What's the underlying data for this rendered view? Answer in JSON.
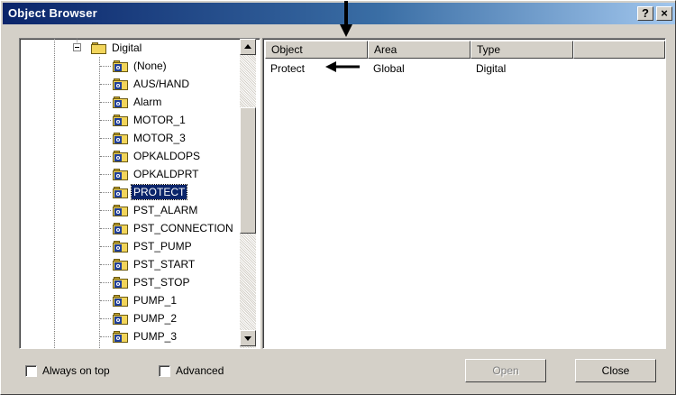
{
  "window": {
    "title": "Object Browser",
    "help_glyph": "?",
    "close_glyph": "×"
  },
  "tree": {
    "parent": {
      "label": "Digital",
      "icon": "folder-icon",
      "expanded": true
    },
    "badge": "o",
    "items": [
      {
        "label": "(None)"
      },
      {
        "label": "AUS/HAND"
      },
      {
        "label": "Alarm"
      },
      {
        "label": "MOTOR_1"
      },
      {
        "label": "MOTOR_3"
      },
      {
        "label": "OPKALDOPS"
      },
      {
        "label": "OPKALDPRT"
      },
      {
        "label": "PROTECT",
        "selected": true
      },
      {
        "label": "PST_ALARM"
      },
      {
        "label": "PST_CONNECTION"
      },
      {
        "label": "PST_PUMP"
      },
      {
        "label": "PST_START"
      },
      {
        "label": "PST_STOP"
      },
      {
        "label": "PUMP_1"
      },
      {
        "label": "PUMP_2"
      },
      {
        "label": "PUMP_3"
      }
    ]
  },
  "list": {
    "columns": [
      "Object",
      "Area",
      "Type"
    ],
    "rows": [
      [
        "Protect",
        "Global",
        "Digital"
      ]
    ]
  },
  "options": {
    "always_on_top": {
      "label": "Always on top",
      "checked": false
    },
    "advanced": {
      "label": "Advanced",
      "checked": false
    }
  },
  "buttons": {
    "open": {
      "label": "Open",
      "enabled": false
    },
    "close": {
      "label": "Close",
      "enabled": true
    }
  },
  "colors": {
    "selection": "#0a246a",
    "title_gradient_start": "#0a246a",
    "title_gradient_end": "#a6caf0",
    "face": "#d4d0c8"
  }
}
